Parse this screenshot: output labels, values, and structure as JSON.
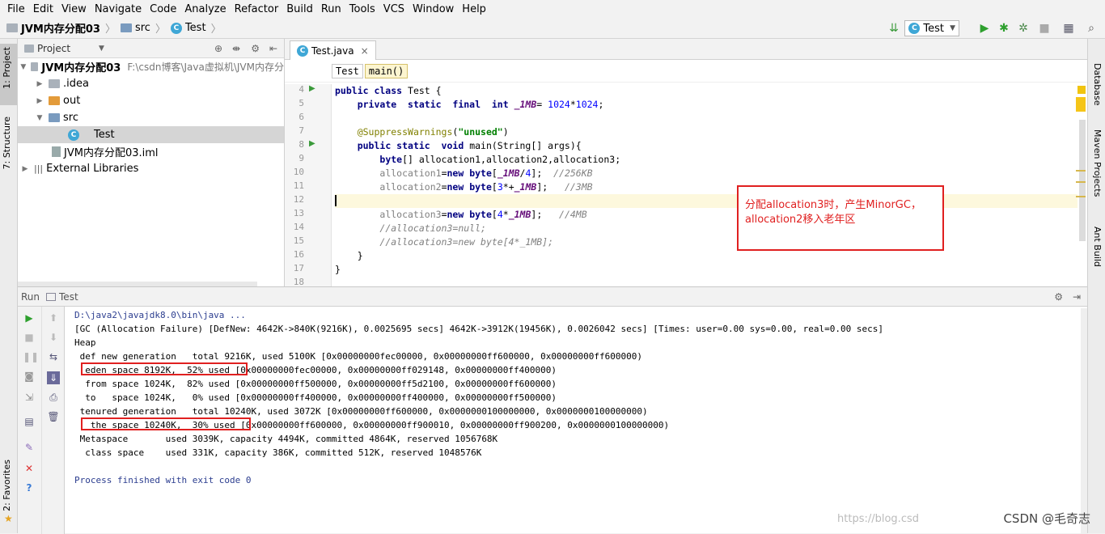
{
  "menu": [
    "File",
    "Edit",
    "View",
    "Navigate",
    "Code",
    "Analyze",
    "Refactor",
    "Build",
    "Run",
    "Tools",
    "VCS",
    "Window",
    "Help"
  ],
  "breadcrumb": {
    "project": "JVM内存分配03",
    "src": "src",
    "file": "Test"
  },
  "run_config": "Test",
  "left_tabs": {
    "project": "1: Project",
    "structure": "7: Structure",
    "favorites": "2: Favorites"
  },
  "right_tabs": {
    "database": "Database",
    "maven": "Maven Projects",
    "ant": "Ant Build"
  },
  "project_panel": {
    "title": "Project",
    "root_name": "JVM内存分配03",
    "root_path": "F:\\csdn博客\\Java虚拟机\\JVM内存分",
    "items": [
      ".idea",
      "out",
      "src",
      "Test",
      "JVM内存分配03.iml",
      "External Libraries"
    ]
  },
  "editor": {
    "tab": "Test.java",
    "crumbs": [
      "Test",
      "main()"
    ],
    "line_numbers": [
      "4",
      "5",
      "6",
      "7",
      "8",
      "9",
      "10",
      "11",
      "12",
      "13",
      "14",
      "15",
      "16",
      "17",
      "18"
    ]
  },
  "callout": "分配allocation3时，产生MinorGC，allocation2移入老年区",
  "run_panel": {
    "title": "Run",
    "tab": "Test",
    "lines": [
      "D:\\java2\\javajdk8.0\\bin\\java ...",
      "[GC (Allocation Failure) [DefNew: 4642K->840K(9216K), 0.0025695 secs] 4642K->3912K(19456K), 0.0026042 secs] [Times: user=0.00 sys=0.00, real=0.00 secs]",
      "Heap",
      " def new generation   total 9216K, used 5100K [0x00000000fec00000, 0x00000000ff600000, 0x00000000ff600000)",
      "  eden space 8192K,  52% used [0x00000000fec00000, 0x00000000ff029148, 0x00000000ff400000)",
      "  from space 1024K,  82% used [0x00000000ff500000, 0x00000000ff5d2100, 0x00000000ff600000)",
      "  to   space 1024K,   0% used [0x00000000ff400000, 0x00000000ff400000, 0x00000000ff500000)",
      " tenured generation   total 10240K, used 3072K [0x00000000ff600000, 0x0000000100000000, 0x0000000100000000)",
      "   the space 10240K,  30% used [0x00000000ff600000, 0x00000000ff900010, 0x00000000ff900200, 0x0000000100000000)",
      " Metaspace       used 3039K, capacity 4494K, committed 4864K, reserved 1056768K",
      "  class space    used 331K, capacity 386K, committed 512K, reserved 1048576K",
      "",
      "Process finished with exit code 0"
    ]
  },
  "watermark": "CSDN @毛奇志",
  "watermark_url": "https://blog.csd"
}
